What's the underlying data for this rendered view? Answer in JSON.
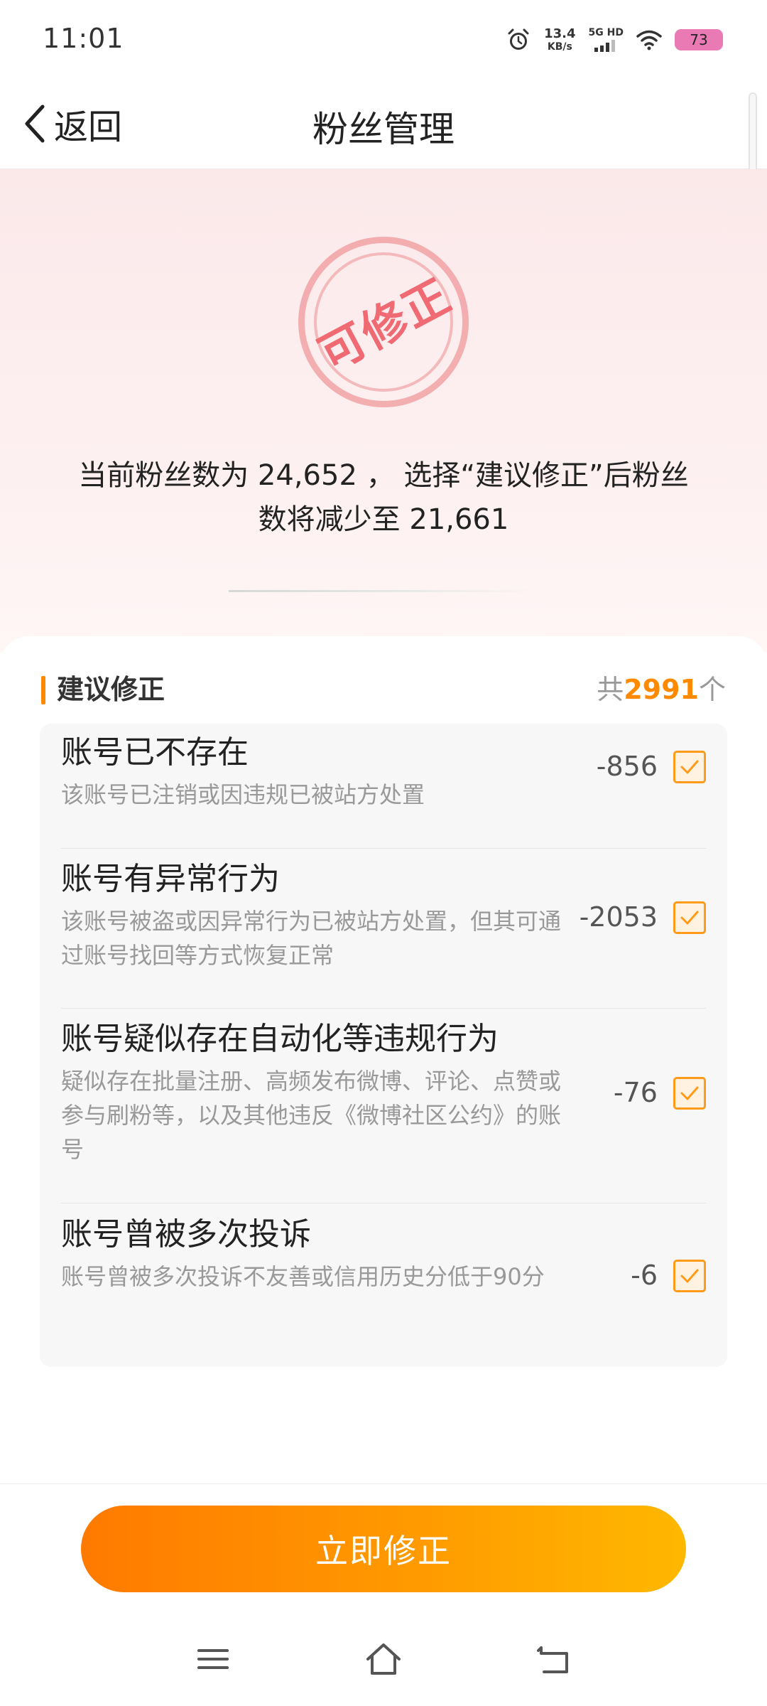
{
  "status_bar": {
    "time": "11:01",
    "net_speed_value": "13.4",
    "net_speed_unit": "KB/s",
    "network_type": "5G HD",
    "battery": "73",
    "battery_color": "#e97ab3"
  },
  "nav": {
    "back_label": "返回",
    "title": "粉丝管理"
  },
  "hero": {
    "stamp_text": "可修正",
    "message_line1": "当前粉丝数为 24,652 ， 选择“建议修正”后粉丝",
    "message_line2": "数将减少至 21,661"
  },
  "section": {
    "title": "建议修正",
    "total_prefix": "共",
    "total_count": "2991",
    "total_suffix": "个"
  },
  "items": [
    {
      "title": "账号已不存在",
      "desc": "该账号已注销或因违规已被站方处置",
      "count": "-856",
      "checked": true
    },
    {
      "title": "账号有异常行为",
      "desc": "该账号被盗或因异常行为已被站方处置，但其可通过账号找回等方式恢复正常",
      "count": "-2053",
      "checked": true
    },
    {
      "title": "账号疑似存在自动化等违规行为",
      "desc": "疑似存在批量注册、高频发布微博、评论、点赞或参与刷粉等，以及其他违反《微博社区公约》的账号",
      "count": "-76",
      "checked": true
    },
    {
      "title": "账号曾被多次投诉",
      "desc": "账号曾被多次投诉不友善或信用历史分低于90分",
      "count": "-6",
      "checked": true
    }
  ],
  "action": {
    "button_label": "立即修正"
  },
  "colors": {
    "accent": "#ff8a00",
    "stamp": "#ef6a72"
  },
  "icons": [
    "alarm-icon",
    "signal-icon",
    "wifi-icon",
    "back-chevron-icon",
    "check-icon",
    "menu-icon",
    "home-icon",
    "back-icon"
  ]
}
